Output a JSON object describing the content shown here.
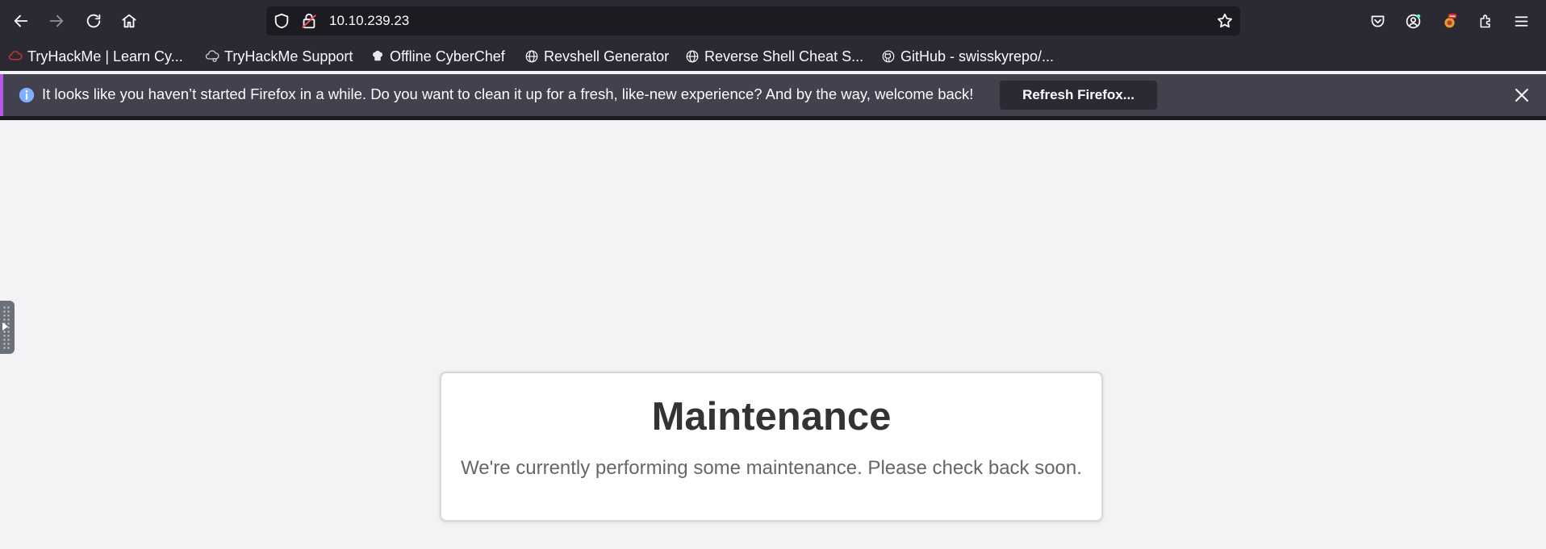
{
  "browser": {
    "url": "10.10.239.23",
    "nav": {
      "back_icon": "arrow-left-icon",
      "forward_icon": "arrow-right-icon",
      "reload_icon": "reload-icon",
      "home_icon": "home-icon"
    },
    "toolbar_right_icons": [
      "pocket-icon",
      "account-icon",
      "extension-badge-icon",
      "extensions-icon",
      "hamburger-menu-icon"
    ]
  },
  "bookmarks": [
    {
      "label": "TryHackMe | Learn Cy...",
      "icon": "tryhackme-icon"
    },
    {
      "label": "TryHackMe Support",
      "icon": "cloud-icon"
    },
    {
      "label": "Offline CyberChef",
      "icon": "chef-hat-icon"
    },
    {
      "label": "Revshell Generator",
      "icon": "globe-icon"
    },
    {
      "label": "Reverse Shell Cheat S...",
      "icon": "globe-icon"
    },
    {
      "label": "GitHub - swisskyrepo/...",
      "icon": "github-icon"
    }
  ],
  "notification": {
    "message": "It looks like you haven’t started Firefox in a while. Do you want to clean it up for a fresh, like-new experience? And by the way, welcome back!",
    "button_label": "Refresh Firefox...",
    "accent_color": "#b45ae6"
  },
  "page": {
    "title": "Maintenance",
    "message": "We're currently performing some maintenance. Please check back soon."
  }
}
